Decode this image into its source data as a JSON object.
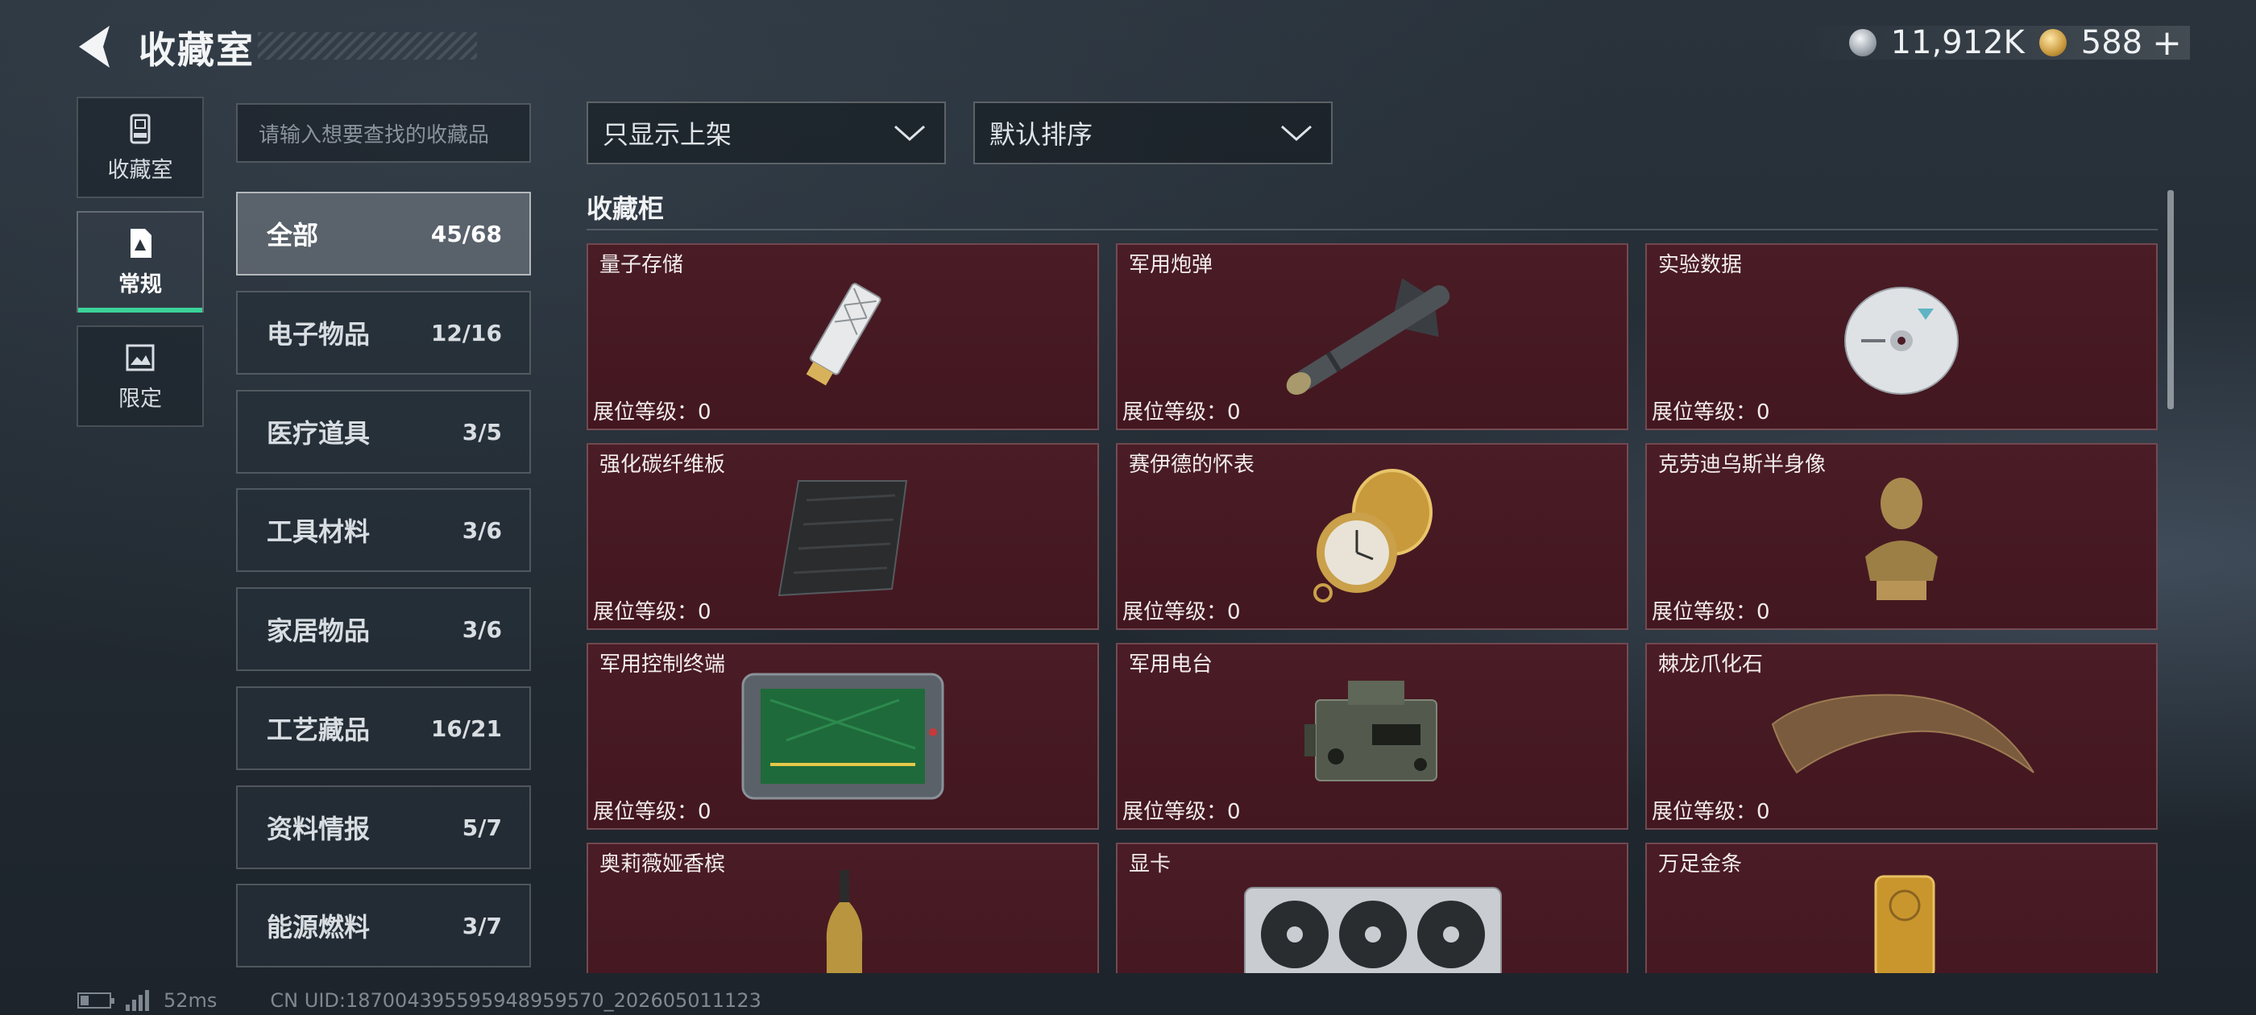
{
  "header": {
    "title": "收藏室",
    "currency_silver": "11,912K",
    "currency_gold": "588",
    "plus_label": "+"
  },
  "rail": [
    {
      "label": "收藏室",
      "icon": "trophy-cabinet-icon"
    },
    {
      "label": "常规",
      "icon": "document-icon",
      "active": true
    },
    {
      "label": "限定",
      "icon": "picture-icon"
    }
  ],
  "search": {
    "placeholder": "请输入想要查找的收藏品"
  },
  "categories": [
    {
      "name": "全部",
      "count": "45/68",
      "active": true
    },
    {
      "name": "电子物品",
      "count": "12/16"
    },
    {
      "name": "医疗道具",
      "count": "3/5"
    },
    {
      "name": "工具材料",
      "count": "3/6"
    },
    {
      "name": "家居物品",
      "count": "3/6"
    },
    {
      "name": "工艺藏品",
      "count": "16/21"
    },
    {
      "name": "资料情报",
      "count": "5/7"
    },
    {
      "name": "能源燃料",
      "count": "3/7"
    }
  ],
  "filters": {
    "shelf": "只显示上架",
    "sort": "默认排序"
  },
  "section_title": "收藏柜",
  "items": [
    {
      "name": "量子存储",
      "level": "展位等级：0",
      "icon": "quantum-storage-chip-icon"
    },
    {
      "name": "军用炮弹",
      "level": "展位等级：0",
      "icon": "missile-icon"
    },
    {
      "name": "实验数据",
      "level": "展位等级：0",
      "icon": "data-disc-icon"
    },
    {
      "name": "强化碳纤维板",
      "level": "展位等级：0",
      "icon": "carbon-fiber-plate-icon"
    },
    {
      "name": "赛伊德的怀表",
      "level": "展位等级：0",
      "icon": "pocket-watch-icon"
    },
    {
      "name": "克劳迪乌斯半身像",
      "level": "展位等级：0",
      "icon": "bust-statue-icon"
    },
    {
      "name": "军用控制终端",
      "level": "展位等级：0",
      "icon": "control-terminal-icon"
    },
    {
      "name": "军用电台",
      "level": "展位等级：0",
      "icon": "military-radio-icon"
    },
    {
      "name": "棘龙爪化石",
      "level": "展位等级：0",
      "icon": "claw-fossil-icon"
    },
    {
      "name": "奥莉薇娅香槟",
      "level": "",
      "icon": "champagne-bottle-icon"
    },
    {
      "name": "显卡",
      "level": "",
      "icon": "graphics-card-icon"
    },
    {
      "name": "万足金条",
      "level": "",
      "icon": "gold-bar-icon"
    }
  ],
  "footer": {
    "ping": "52ms",
    "uid": "CN UID:187004395595948959570_202605011123"
  },
  "colors": {
    "item_bg": "#4a1c26",
    "active_underline": "#3bd39a"
  }
}
